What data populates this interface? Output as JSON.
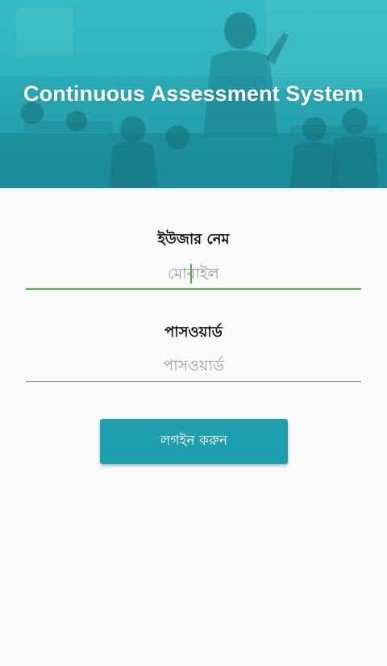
{
  "header": {
    "title": "Continuous Assessment System",
    "background_image": "classroom-teacher-photo",
    "overlay_color": "#26b3bd"
  },
  "form": {
    "username": {
      "label": "ইউজার নেম",
      "placeholder": "মোবাইল",
      "value": "",
      "focused": true
    },
    "password": {
      "label": "পাসওয়ার্ড",
      "placeholder": "পাসওয়ার্ড",
      "value": ""
    },
    "submit_label": "লগইন করুন"
  },
  "colors": {
    "accent": "#1f9eae",
    "focus": "#4caf50",
    "background": "#fafafa"
  }
}
